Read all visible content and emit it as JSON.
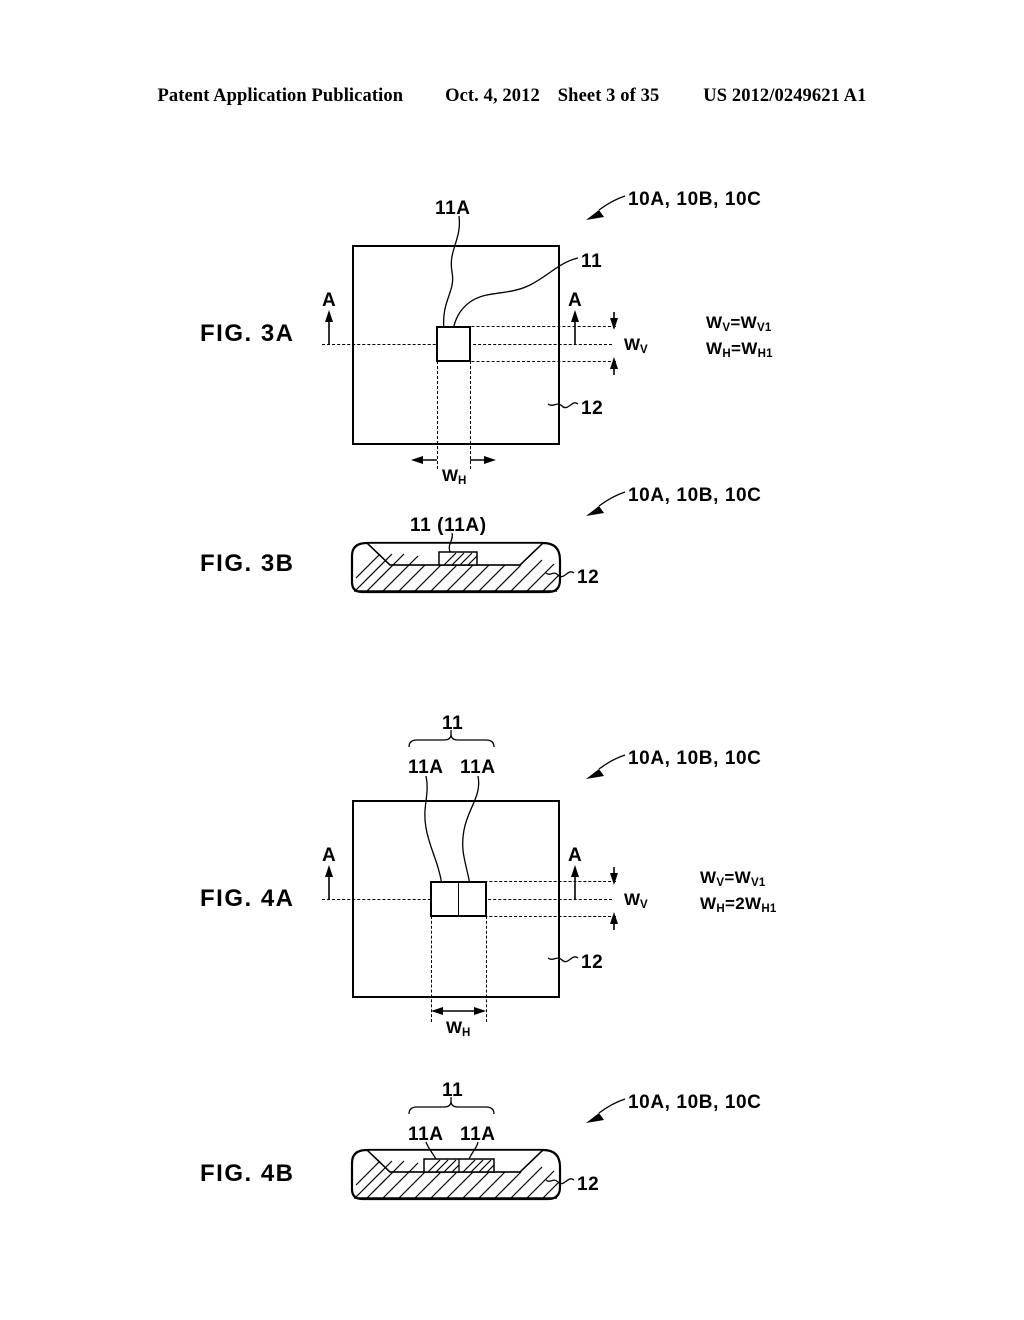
{
  "header": {
    "publication": "Patent Application Publication",
    "date": "Oct. 4, 2012",
    "sheet": "Sheet 3 of 35",
    "patent_number": "US 2012/0249621 A1"
  },
  "figures": [
    {
      "id": "fig3a",
      "label": "FIG. 3A",
      "type": "plan-view",
      "assembly_ref": "10A, 10B, 10C",
      "callouts": {
        "chip_sub": "11A",
        "chip": "11",
        "substrate": "12"
      },
      "section_letters": {
        "left": "A",
        "right": "A"
      },
      "dimensions": {
        "vertical": "W",
        "vertical_sub": "V",
        "horizontal": "W",
        "horizontal_sub": "H"
      },
      "equations": [
        {
          "lhs": "W",
          "lhs_sub": "V",
          "op": "=",
          "rhs": "W",
          "rhs_sub": "V1"
        },
        {
          "lhs": "W",
          "lhs_sub": "H",
          "op": "=",
          "rhs": "W",
          "rhs_sub": "H1"
        }
      ]
    },
    {
      "id": "fig3b",
      "label": "FIG. 3B",
      "type": "cross-section",
      "assembly_ref": "10A, 10B, 10C",
      "callouts": {
        "chip": "11 (11A)",
        "substrate": "12"
      }
    },
    {
      "id": "fig4a",
      "label": "FIG. 4A",
      "type": "plan-view",
      "assembly_ref": "10A, 10B, 10C",
      "callouts": {
        "brace": "11",
        "chip_sub_left": "11A",
        "chip_sub_right": "11A",
        "substrate": "12"
      },
      "section_letters": {
        "left": "A",
        "right": "A"
      },
      "dimensions": {
        "vertical": "W",
        "vertical_sub": "V",
        "horizontal": "W",
        "horizontal_sub": "H"
      },
      "equations": [
        {
          "lhs": "W",
          "lhs_sub": "V",
          "op": "=",
          "rhs": "W",
          "rhs_sub": "V1"
        },
        {
          "lhs": "W",
          "lhs_sub": "H",
          "op": "=",
          "rhs": "2W",
          "rhs_sub": "H1"
        }
      ]
    },
    {
      "id": "fig4b",
      "label": "FIG. 4B",
      "type": "cross-section",
      "assembly_ref": "10A, 10B, 10C",
      "callouts": {
        "brace": "11",
        "chip_sub_left": "11A",
        "chip_sub_right": "11A",
        "substrate": "12"
      }
    }
  ],
  "colors": {
    "ink": "#000000",
    "paper": "#ffffff"
  }
}
